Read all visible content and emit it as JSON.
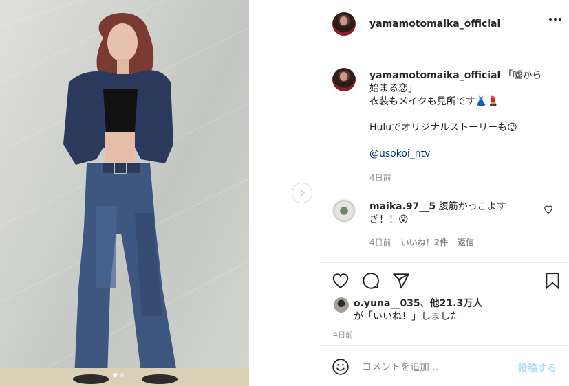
{
  "post": {
    "image_alt": "",
    "carousel": {
      "total": 2,
      "active": 0,
      "next_icon": "chevron-right-icon"
    }
  },
  "header": {
    "username": "yamamotomaika_official",
    "more_icon": "more-horizontal-icon"
  },
  "caption": {
    "username": "yamamotomaika_official",
    "line1": "「嘘から始まる恋」",
    "line2": "衣装もメイクも見所です👗💄",
    "line3": "Huluでオリジナルストーリーも😜",
    "mention": "@usokoi_ntv",
    "timestamp": "4日前"
  },
  "comment": {
    "username": "maika.97__5",
    "text": "腹筋かっこよすぎ！！😵",
    "timestamp": "4日前",
    "likes": "いいね！2件",
    "reply": "返信",
    "like_icon": "heart-outline-icon"
  },
  "actions": {
    "like_icon": "heart-outline-icon",
    "comment_icon": "comment-bubble-icon",
    "share_icon": "paper-plane-icon",
    "save_icon": "bookmark-outline-icon"
  },
  "liked_by": {
    "username": "o.yuna__035",
    "others": "他21.3万人",
    "suffix": "が「いいね！」しました",
    "separator": "、"
  },
  "post_timestamp": "4日前",
  "add_comment": {
    "emoji_icon": "smiley-icon",
    "placeholder": "コメントを追加...",
    "post_label": "投稿する"
  },
  "colors": {
    "text": "#262626",
    "secondary": "#8e8e8e",
    "link": "#00376b",
    "post_button_disabled": "#b2dffc",
    "border": "#efefef"
  }
}
